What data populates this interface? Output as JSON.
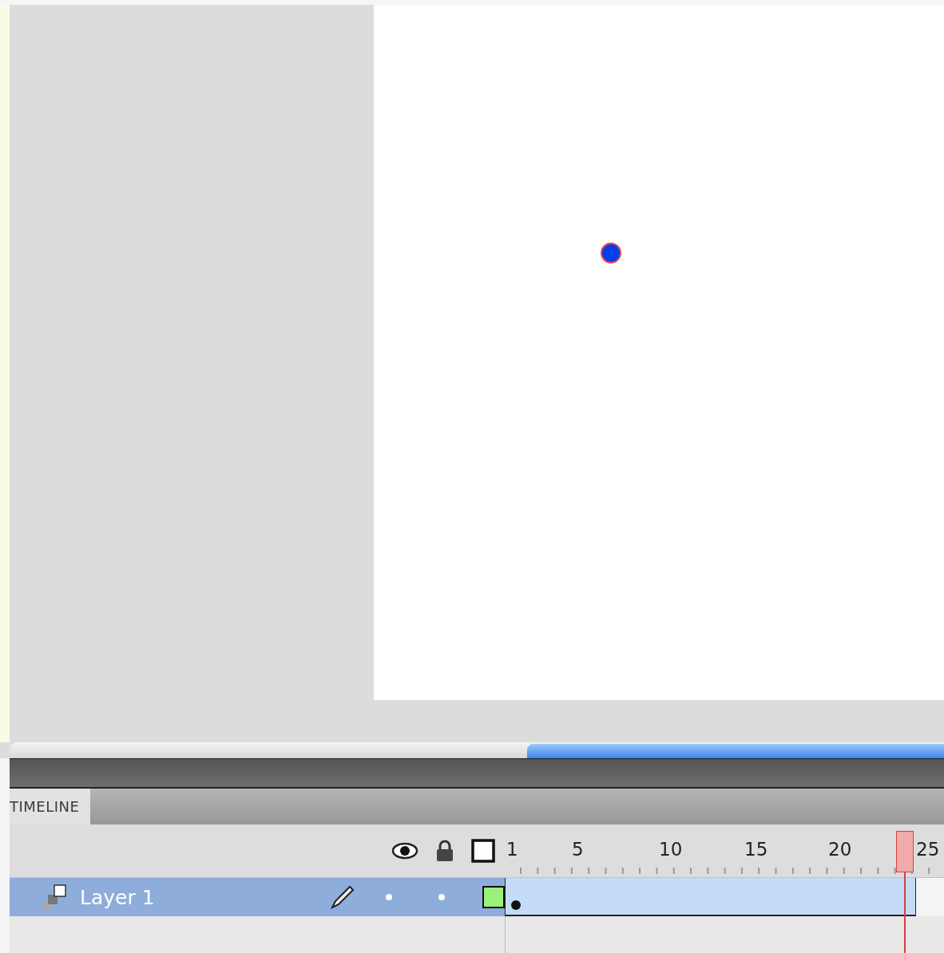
{
  "timeline": {
    "tabs": [
      {
        "label": "TIMELINE",
        "selected": true
      }
    ],
    "frame_labels": [
      "1",
      "5",
      "10",
      "15",
      "20",
      "25"
    ],
    "layers": [
      {
        "name": "Layer 1",
        "selected": true,
        "color": "#99f27a"
      }
    ]
  }
}
